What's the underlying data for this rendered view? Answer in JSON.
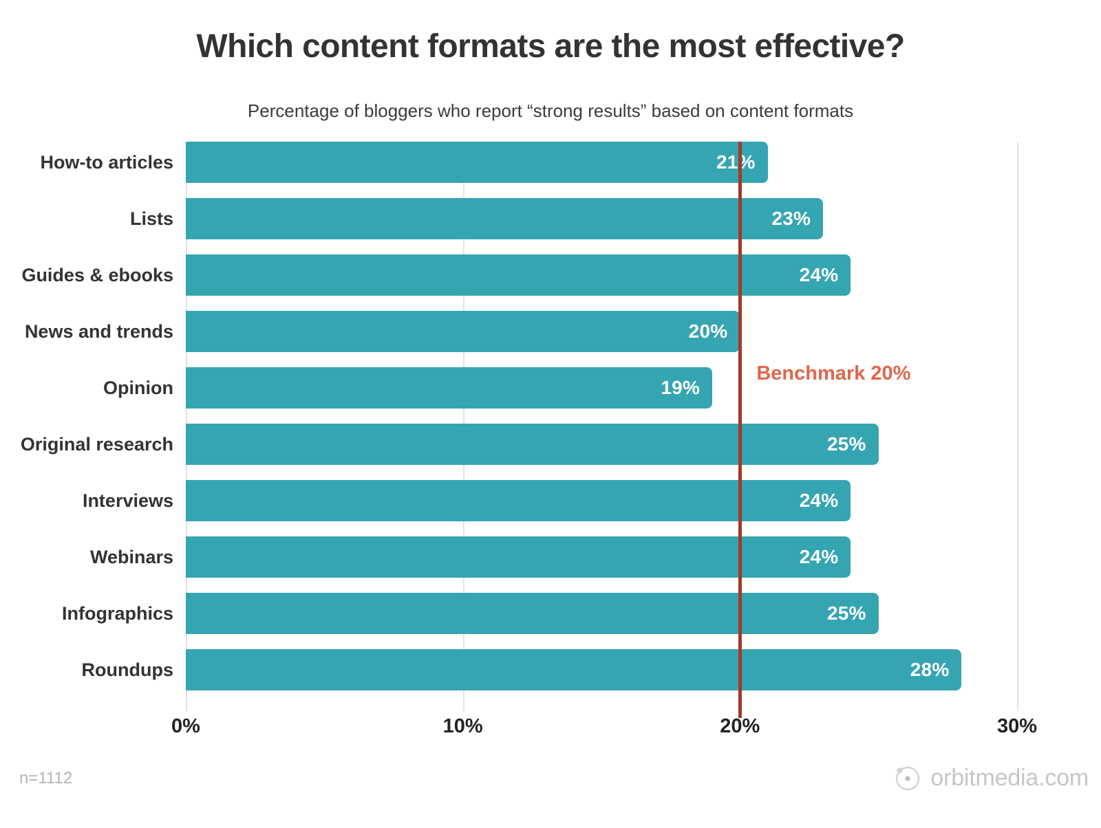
{
  "header": {
    "title": "Which content formats are the most effective?",
    "subtitle": "Percentage of bloggers who report “strong results” based on content formats"
  },
  "footer": {
    "sample_size": "n=1112",
    "brand_name": "orbitmedia.com",
    "brand_icon": "orbit-logo-icon"
  },
  "annotation": {
    "benchmark_label": "Benchmark 20%",
    "benchmark_value": 20
  },
  "colors": {
    "bar": "#36a5b2",
    "benchmark_line": "#a3392a",
    "benchmark_text": "#e0664b",
    "title": "#333333",
    "gridline": "#e3e3e3",
    "value_label": "#ffffff",
    "footnote": "#b3b3b3",
    "brand": "#c6c6c6",
    "background": "#ffffff"
  },
  "chart_data": {
    "type": "bar",
    "orientation": "horizontal",
    "title": "Which content formats are the most effective?",
    "subtitle": "Percentage of bloggers who report “strong results” based on content formats",
    "xlabel": "",
    "ylabel": "",
    "xlim": [
      0,
      30
    ],
    "grid": true,
    "gridlines_x": [
      0,
      10,
      20,
      30
    ],
    "tick_labels": [
      "0%",
      "10%",
      "20%",
      "30%"
    ],
    "legend": null,
    "categories": [
      "How-to articles",
      "Lists",
      "Guides & ebooks",
      "News and trends",
      "Opinion",
      "Original research",
      "Interviews",
      "Webinars",
      "Infographics",
      "Roundups"
    ],
    "values": [
      21,
      23,
      24,
      20,
      19,
      25,
      24,
      24,
      25,
      28
    ],
    "value_labels": [
      "21%",
      "23%",
      "24%",
      "20%",
      "19%",
      "25%",
      "24%",
      "24%",
      "25%",
      "28%"
    ],
    "annotations": [
      {
        "type": "vline",
        "x": 20,
        "label": "Benchmark 20%"
      }
    ],
    "note": "n=1112"
  }
}
